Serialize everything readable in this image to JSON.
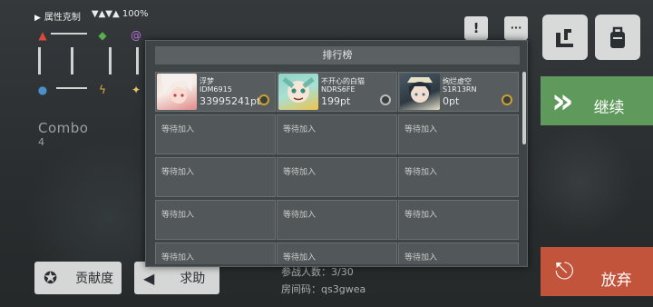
{
  "hud": {
    "attribute_label": "属性克制",
    "signal_text": "▼▲▼▲ 100%",
    "combo_label": "Combo",
    "combo_value": "4"
  },
  "top_right": {
    "badge_1": "!",
    "badge_2": "···"
  },
  "actions": {
    "continue_label": "继续",
    "giveup_label": "放弃",
    "contribution_label": "贡献度",
    "help_label": "求助"
  },
  "room": {
    "participants_text": "参战人数：3/30",
    "room_code_text": "房间码：qs3gwea"
  },
  "leaderboard": {
    "title": "排行榜",
    "players": [
      {
        "name": "浮梦",
        "id": "IDM6915",
        "points": "33995241pt",
        "medal": "gold"
      },
      {
        "name": "不开心的白猫",
        "id": "NDRS6FE",
        "points": "199pt",
        "medal": "silver"
      },
      {
        "name": "绚烂虚空",
        "id": "S1R13RN",
        "points": "0pt",
        "medal": "gold"
      }
    ],
    "waiting_text": "等待加入"
  },
  "colors": {
    "continue": "#5f9a5c",
    "giveup": "#c2543b",
    "panel": "#3f4446"
  },
  "icons": [
    "wrench-icon",
    "backpack-icon",
    "chevron-right-icon",
    "exit-icon",
    "medal-icon",
    "megaphone-icon"
  ]
}
